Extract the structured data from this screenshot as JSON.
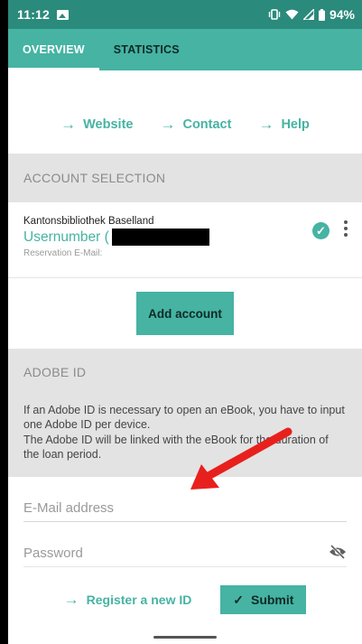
{
  "status_bar": {
    "time": "11:12",
    "battery": "94%"
  },
  "tabs": [
    {
      "label": "OVERVIEW",
      "active": true
    },
    {
      "label": "STATISTICS",
      "active": false
    }
  ],
  "links": [
    {
      "label": "Website"
    },
    {
      "label": "Contact"
    },
    {
      "label": "Help"
    }
  ],
  "account_section": {
    "header": "ACCOUNT SELECTION",
    "account": {
      "library": "Kantonsbibliothek Baselland",
      "user_prefix": "Usernumber (",
      "email_label": "Reservation E-Mail:"
    },
    "add_button": "Add account"
  },
  "adobe_section": {
    "header": "ADOBE ID",
    "description": "If an Adobe ID is necessary to open an eBook, you have to input one Adobe ID per device.\nThe Adobe ID will be linked with the eBook for the duration of the loan period.",
    "email_placeholder": "E-Mail address",
    "password_placeholder": "Password",
    "register_label": "Register a new ID",
    "submit_label": "Submit"
  },
  "colors": {
    "accent": "#46b3a3",
    "status_bar": "#2a8a7c",
    "annotation_arrow": "#e8201d"
  }
}
